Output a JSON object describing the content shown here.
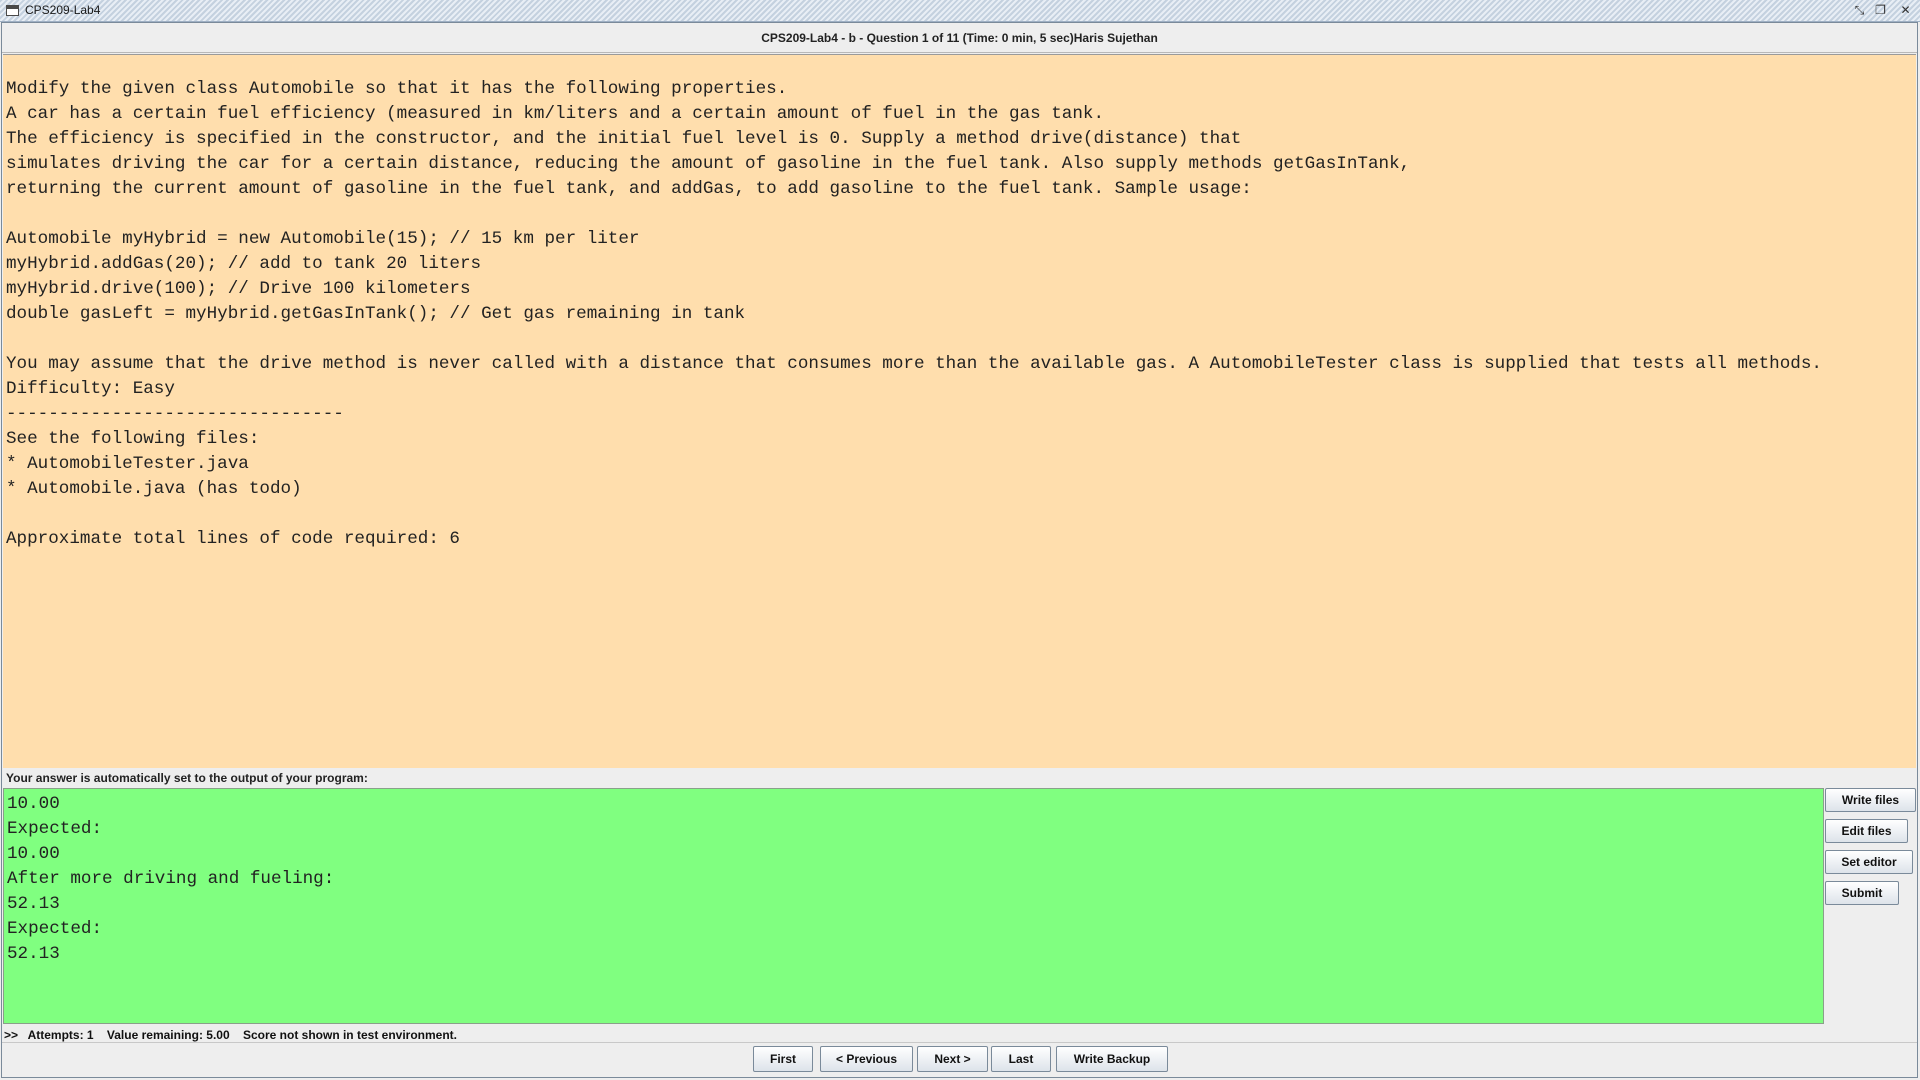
{
  "window": {
    "title": "CPS209-Lab4",
    "controls": {
      "minimize": "⤡",
      "maximize": "❐",
      "close": "✕"
    }
  },
  "header": {
    "text": "CPS209-Lab4 - b - Question 1 of 11      (Time: 0 min, 5 sec)Haris Sujethan"
  },
  "question": {
    "text": "Modify the given class Automobile so that it has the following properties.\nA car has a certain fuel efficiency (measured in km/liters and a certain amount of fuel in the gas tank.\nThe efficiency is specified in the constructor, and the initial fuel level is 0. Supply a method drive(distance) that\nsimulates driving the car for a certain distance, reducing the amount of gasoline in the fuel tank. Also supply methods getGasInTank,\nreturning the current amount of gasoline in the fuel tank, and addGas, to add gasoline to the fuel tank. Sample usage:\n\nAutomobile myHybrid = new Automobile(15); // 15 km per liter\nmyHybrid.addGas(20); // add to tank 20 liters\nmyHybrid.drive(100); // Drive 100 kilometers\ndouble gasLeft = myHybrid.getGasInTank(); // Get gas remaining in tank\n\nYou may assume that the drive method is never called with a distance that consumes more than the available gas. A AutomobileTester class is supplied that tests all methods.\nDifficulty: Easy\n--------------------------------\nSee the following files:\n* AutomobileTester.java\n* Automobile.java (has todo)\n\nApproximate total lines of code required: 6"
  },
  "answer": {
    "label": "Your answer is automatically set to the output of your program:",
    "output": "10.00\nExpected:\n10.00\nAfter more driving and fueling:\n52.13\nExpected:\n52.13"
  },
  "side_buttons": {
    "write_files": "Write files",
    "edit_files": "Edit files",
    "set_editor": "Set editor",
    "submit": "Submit"
  },
  "status": {
    "text": ">>   Attempts: 1    Value remaining: 5.00    Score not shown in test environment."
  },
  "nav": {
    "first": "First",
    "previous": "< Previous",
    "next": "Next >",
    "last": "Last",
    "write_backup": "Write Backup"
  },
  "colors": {
    "question_bg": "#ffdead",
    "output_bg": "#80ff80",
    "window_bg": "#eeeeee"
  }
}
